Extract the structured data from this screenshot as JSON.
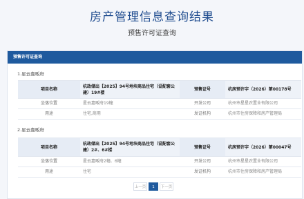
{
  "header": {
    "title": "房产管理信息查询结果",
    "subtitle": "预售许可证查询"
  },
  "panel": {
    "title": "预售许可证查询"
  },
  "labels": {
    "project_name": "项目名称",
    "permit_no": "预售证号",
    "location": "坐落位置",
    "developer": "开发公司",
    "usage": "用途",
    "issuer": "发证机构"
  },
  "records": [
    {
      "section": "1.星云嘉畈府",
      "project_name": "杭政储出【2025】94号地块商品住宅（设配套公建）19#楼",
      "permit_no": "杭房预许字（2026）第00178号",
      "location": "星云嘉畈府19幢",
      "developer": "杭州市星星农置业有限公司",
      "usage": "住宅,商用",
      "issuer": "杭州市住房保障和房产管理局"
    },
    {
      "section": "2.星云嘉畈府",
      "project_name": "杭政储出【2025】94号地块商品住宅（设配套公建）2#、6#楼",
      "permit_no": "杭房预许字（2026）第00047号",
      "location": "星云嘉畈府2幢、6幢",
      "developer": "杭州市星星农置业有限公司",
      "usage": "住宅",
      "issuer": "杭州市住房保障和房产管理局"
    }
  ],
  "pagination": {
    "prev": "上一页",
    "current": "1",
    "next": "下一页"
  }
}
